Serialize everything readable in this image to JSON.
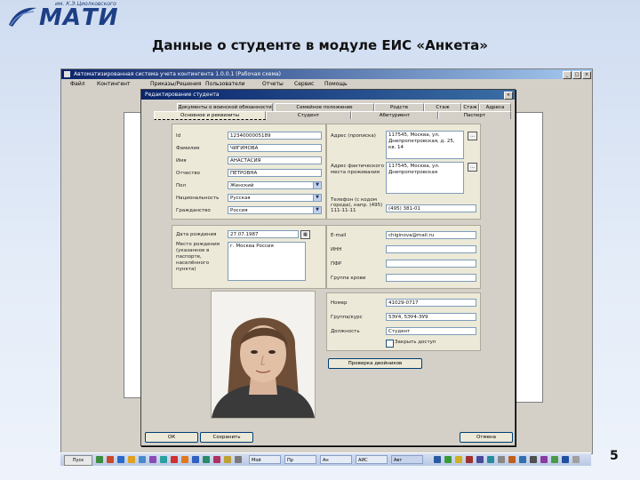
{
  "logo": {
    "subtitle": "им. К.Э.Циолковского",
    "text": "МАТИ"
  },
  "slide": {
    "title": "Данные о студенте в модуле ЕИС «Анкета»",
    "page_number": "5"
  },
  "app": {
    "title": "Автоматизированная система учета контингента 1.0.0.1 (Рабочая схема)",
    "menu": [
      "Файл",
      "Контингент",
      "Приказы/Решения",
      "Пользователи",
      "Отчеты",
      "Сервис",
      "Помощь"
    ]
  },
  "dialog": {
    "title": "Редактирование студента",
    "tabs_top": [
      "Документы о воинской обязанности",
      "Семейное положение",
      "Родств",
      "Стаж",
      "Стаж",
      "Адреса"
    ],
    "tabs_bottom": [
      "Основное и реквизиты",
      "Студент",
      "Абитуриент",
      "Паспорт"
    ],
    "personal": {
      "id_label": "Id",
      "id_value": "1234000005189",
      "lastname_label": "Фамилия",
      "lastname_value": "ЧИГИНОВА",
      "firstname_label": "Имя",
      "firstname_value": "АНАСТАСИЯ",
      "patronymic_label": "Отчество",
      "patronymic_value": "ПЕТРОВНА",
      "sex_label": "Пол",
      "sex_value": "Женский",
      "nationality_label": "Национальность",
      "nationality_value": "Русская",
      "citizenship_label": "Гражданство",
      "citizenship_value": "Россия"
    },
    "address": {
      "reg_label": "Адрес (прописка)",
      "reg_value": "117545, Москва, ул. Днепропетровская, д. 25, кв. 14",
      "res_label": "Адрес фактического места проживания",
      "res_value": "117545, Москва, ул. Днепропетровская",
      "phone_label": "Телефон (с кодом города), напр. (495) 111-11-11",
      "phone_value": "(495) 381-01"
    },
    "birth": {
      "date_label": "Дата рождения",
      "date_value": "27.07.1987",
      "place_label": "Место рождения (указанное в паспорте, населённого пункта)",
      "place_value": "г. Москва Россия"
    },
    "contacts": {
      "email_label": "E-mail",
      "email_value": "chiginova@mail.ru",
      "inn_label": "ИНН",
      "pfr_label": "ПФР",
      "group_label": "Группа крови"
    },
    "student": {
      "number_label": "Номер",
      "number_value": "41029-0717",
      "group_label": "Группа/курс",
      "group_value": "5ЭУ4, 5ЭУ4-ЭУ9",
      "position_label": "Должность",
      "position_value": "Студент",
      "close_checkbox_label": "Закрыть доступ",
      "check_button": "Проверка двойников"
    },
    "buttons": {
      "ok": "ОК",
      "save": "Сохранить",
      "cancel": "Отмена"
    }
  },
  "taskbar": {
    "start": "Пуск",
    "tasks": [
      "Мой",
      "Пр",
      "Ан",
      "АИС",
      "Авт"
    ]
  },
  "colors": {
    "titlebar": "#0a246a",
    "accent": "#1d3f86"
  }
}
